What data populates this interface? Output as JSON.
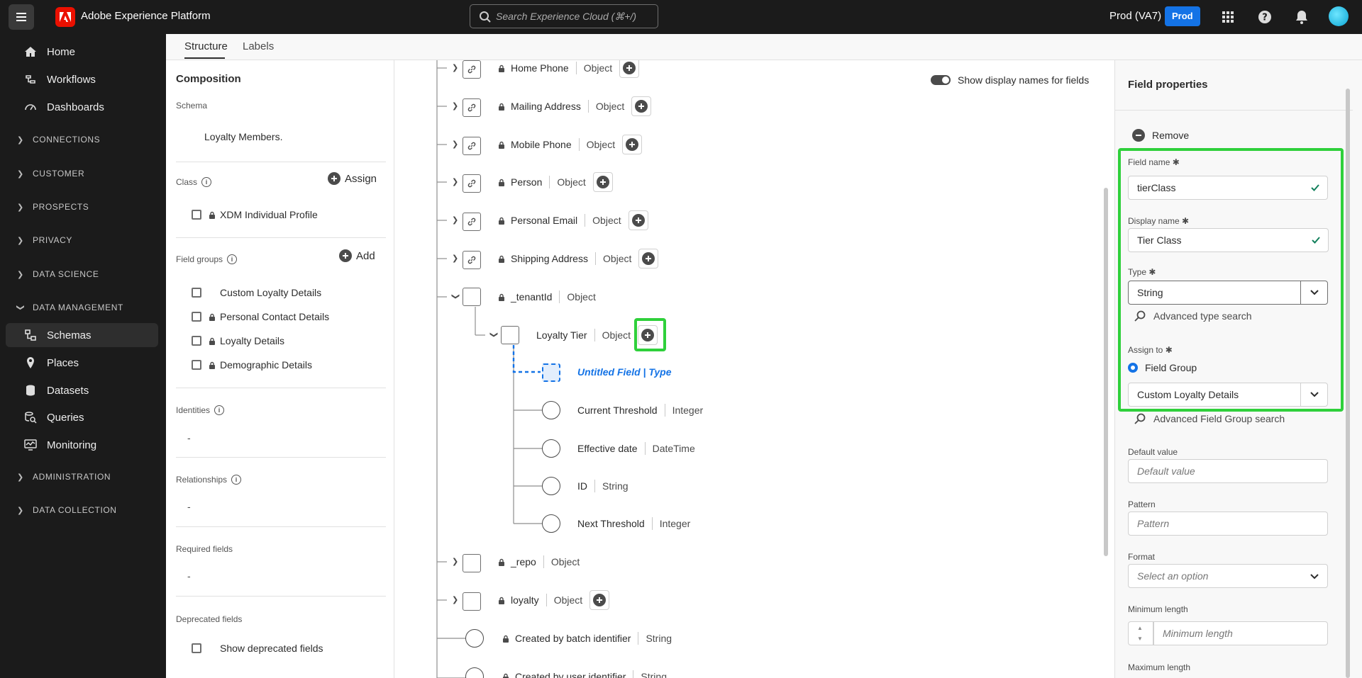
{
  "header": {
    "brand": "Adobe Experience Platform",
    "search_placeholder": "Search Experience Cloud (⌘+/)",
    "org": "Prod (VA7)",
    "sandbox_badge": "Prod"
  },
  "nav": {
    "items": [
      {
        "label": "Home",
        "icon": "home-icon"
      },
      {
        "label": "Workflows",
        "icon": "workflows-icon"
      },
      {
        "label": "Dashboards",
        "icon": "dashboards-icon"
      }
    ],
    "sections": [
      "CONNECTIONS",
      "CUSTOMER",
      "PROSPECTS",
      "PRIVACY",
      "DATA SCIENCE",
      "DATA MANAGEMENT"
    ],
    "data_management_items": [
      {
        "label": "Schemas",
        "icon": "schemas-icon",
        "active": true
      },
      {
        "label": "Places",
        "icon": "places-icon"
      },
      {
        "label": "Datasets",
        "icon": "datasets-icon"
      },
      {
        "label": "Queries",
        "icon": "queries-icon"
      },
      {
        "label": "Monitoring",
        "icon": "monitoring-icon"
      }
    ],
    "bottom_sections": [
      "ADMINISTRATION",
      "DATA COLLECTION"
    ]
  },
  "tabs": [
    "Structure",
    "Labels"
  ],
  "composition": {
    "title": "Composition",
    "schema_label": "Schema",
    "schema_name": "Loyalty Members.",
    "class_label": "Class",
    "assign_label": "Assign",
    "class_item": "XDM Individual Profile",
    "field_groups_label": "Field groups",
    "add_label": "Add",
    "field_groups": [
      {
        "name": "Custom Loyalty Details",
        "locked": false
      },
      {
        "name": "Personal Contact Details",
        "locked": true
      },
      {
        "name": "Loyalty Details",
        "locked": true
      },
      {
        "name": "Demographic Details",
        "locked": true
      }
    ],
    "identities_label": "Identities",
    "identities_value": "-",
    "relationships_label": "Relationships",
    "relationships_value": "-",
    "required_label": "Required fields",
    "required_value": "-",
    "deprecated_label": "Deprecated fields",
    "show_deprecated": "Show deprecated fields"
  },
  "canvas": {
    "toggle_label": "Show display names for fields",
    "top_fields": [
      {
        "name": "Home Phone",
        "type": "Object"
      },
      {
        "name": "Mailing Address",
        "type": "Object"
      },
      {
        "name": "Mobile Phone",
        "type": "Object"
      },
      {
        "name": "Person",
        "type": "Object"
      },
      {
        "name": "Personal Email",
        "type": "Object"
      },
      {
        "name": "Shipping Address",
        "type": "Object"
      }
    ],
    "tenant": {
      "name": "_tenantId",
      "type": "Object"
    },
    "loyalty_tier": {
      "name": "Loyalty Tier",
      "type": "Object"
    },
    "untitled": "Untitled Field | Type",
    "tier_children": [
      {
        "name": "Current Threshold",
        "type": "Integer"
      },
      {
        "name": "Effective date",
        "type": "DateTime"
      },
      {
        "name": "ID",
        "type": "String"
      },
      {
        "name": "Next Threshold",
        "type": "Integer"
      }
    ],
    "repo": {
      "name": "_repo",
      "type": "Object"
    },
    "loyalty": {
      "name": "loyalty",
      "type": "Object"
    },
    "created_batch": {
      "name": "Created by batch identifier",
      "type": "String"
    },
    "created_user": {
      "name": "Created by user identifier",
      "type": "String"
    }
  },
  "properties": {
    "title": "Field properties",
    "remove_label": "Remove",
    "field_name_label": "Field name",
    "field_name_value": "tierClass",
    "display_name_label": "Display name",
    "display_name_value": "Tier Class",
    "type_label": "Type",
    "type_value": "String",
    "advanced_type_search": "Advanced type search",
    "assign_to_label": "Assign to",
    "assign_option": "Field Group",
    "field_group_value": "Custom Loyalty Details",
    "advanced_fg_search": "Advanced Field Group search",
    "default_value_label": "Default value",
    "default_value_placeholder": "Default value",
    "pattern_label": "Pattern",
    "pattern_placeholder": "Pattern",
    "format_label": "Format",
    "format_placeholder": "Select an option",
    "min_length_label": "Minimum length",
    "min_length_placeholder": "Minimum length",
    "max_length_label": "Maximum length"
  },
  "colors": {
    "highlight": "#2fd03b",
    "accent": "#1473e6",
    "topbar": "#1b1b1b"
  }
}
